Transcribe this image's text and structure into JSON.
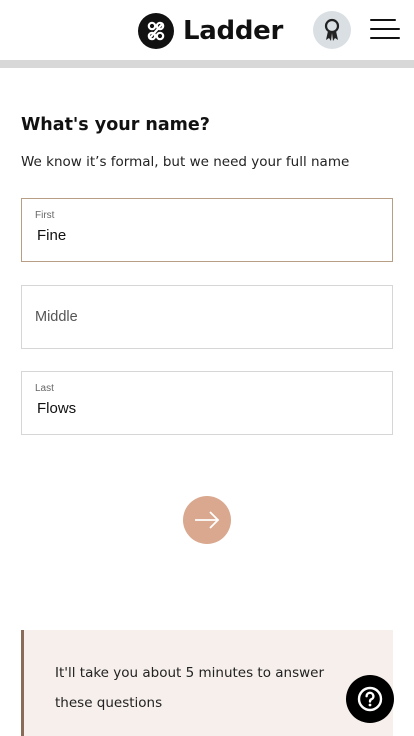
{
  "header": {
    "brand": "Ladder",
    "icons": [
      "ladder-logo-icon",
      "award-ribbon-icon",
      "hamburger-menu-icon"
    ]
  },
  "question": {
    "title": "What's your name?",
    "subtitle": "We know it’s formal, but we need your full name"
  },
  "fields": {
    "first": {
      "label": "First",
      "value": "Fine"
    },
    "middle": {
      "placeholder": "Middle",
      "value": ""
    },
    "last": {
      "label": "Last",
      "value": "Flows"
    }
  },
  "next_button": {
    "icon": "arrow-right-icon"
  },
  "info_box": {
    "text": "It'll take you about 5 minutes to answer these questions"
  },
  "help_button": {
    "icon": "question-mark-icon"
  },
  "colors": {
    "accent": "#d9a88e",
    "active_border": "#b89e85",
    "info_bg": "#f6efec",
    "info_border": "#8a6b5a",
    "header_bar": "#d8d8d8"
  }
}
